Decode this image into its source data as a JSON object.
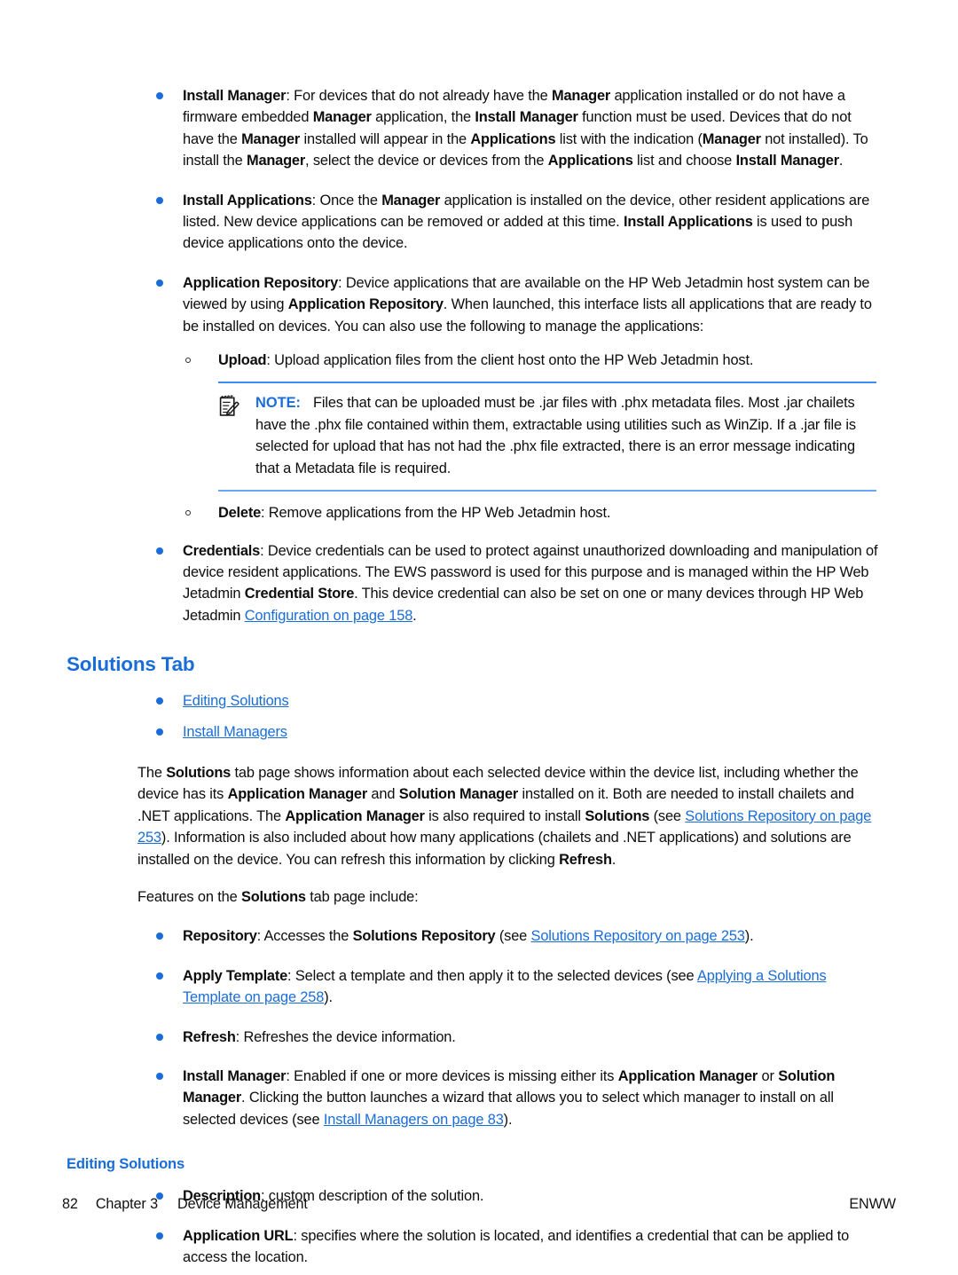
{
  "document": {
    "page_number": "82",
    "chapter": "Chapter 3",
    "chapter_title": "Device Management",
    "footer_right": "ENWW",
    "accent_color": "#1a6dd8",
    "link_color": "#1a6dd8"
  },
  "bullets_top": [
    {
      "name": "install-manager",
      "term": "Install Manager",
      "text_html": "<b>Install Manager</b>: For devices that do not already have the <b>Manager</b> application installed or do not have a firmware embedded <b>Manager</b> application, the <b>Install Manager</b> function must be used. Devices that do not have the <b>Manager</b> installed will appear in the <b>Applications</b> list with the indication (<b>Manager</b> not installed). To install the <b>Manager</b>, select the device or devices from the <b>Applications</b> list and choose <b>Install Manager</b>."
    },
    {
      "name": "install-applications",
      "term": "Install Applications",
      "text_html": "<b>Install Applications</b>: Once the <b>Manager</b> application is installed on the device, other resident applications are listed. New device applications can be removed or added at this time. <b>Install Applications</b> is used to push device applications onto the device."
    },
    {
      "name": "application-repository",
      "term": "Application Repository",
      "text_html": "<b>Application Repository</b>: Device applications that are available on the HP Web Jetadmin host system can be viewed by using <b>Application Repository</b>. When launched, this interface lists all applications that are ready to be installed on devices. You can also use the following to manage the applications:"
    }
  ],
  "sub_bullets": [
    {
      "name": "upload",
      "term": "Upload",
      "text_html": "<b>Upload</b>: Upload application files from the client host onto the HP Web Jetadmin host."
    },
    {
      "name": "delete",
      "term": "Delete",
      "text_html": "<b>Delete</b>: Remove applications from the HP Web Jetadmin host."
    }
  ],
  "note": {
    "icon": "note-pad-pencil-icon",
    "label": "NOTE:",
    "text": "Files that can be uploaded must be .jar files with .phx metadata files. Most .jar chailets have the .phx file contained within them, extractable using utilities such as WinZip. If a .jar file is selected for upload that has not had the .phx file extracted, there is an error message indicating that a Metadata file is required."
  },
  "credentials_bullet": {
    "name": "credentials",
    "term": "Credentials",
    "text_html": "<b>Credentials</b>: Device credentials can be used to protect against unauthorized downloading and manipulation of device resident applications. The EWS password is used for this purpose and is managed within the HP Web Jetadmin <b>Credential Store</b>. This device credential can also be set on one or many devices through HP Web Jetadmin <a class=\"xref\" href=\"#\" data-name=\"xref-configuration-158\" data-interactable=\"true\">Configuration on page 158</a>."
  },
  "solutions_tab": {
    "heading": "Solutions Tab",
    "links": [
      {
        "name": "link-editing-solutions",
        "label": "Editing Solutions"
      },
      {
        "name": "link-install-managers",
        "label": "Install Managers"
      }
    ],
    "intro_html": "The <b>Solutions</b> tab page shows information about each selected device within the device list, including whether the device has its <b>Application Manager</b> and <b>Solution Manager</b> installed on it. Both are needed to install chailets and .NET applications. The <b>Application Manager</b> is also required to install <b>Solutions</b> (see <a class=\"xref\" href=\"#\" data-name=\"xref-solutions-repository-253\" data-interactable=\"true\">Solutions Repository on page 253</a>). Information is also included about how many applications (chailets and .NET applications) and solutions are installed on the device. You can refresh this information by clicking <b>Refresh</b>.",
    "features_intro_html": "Features on the <b>Solutions</b> tab page include:",
    "features": [
      {
        "name": "repository",
        "term": "Repository",
        "text_html": "<b>Repository</b>: Accesses the <b>Solutions Repository</b> (see <a class=\"xref\" href=\"#\" data-name=\"xref-solutions-repository-253b\" data-interactable=\"true\">Solutions Repository on page 253</a>)."
      },
      {
        "name": "apply-template",
        "term": "Apply Template",
        "text_html": "<b>Apply Template</b>: Select a template and then apply it to the selected devices (see <a class=\"xref\" href=\"#\" data-name=\"xref-applying-solutions-template-258\" data-interactable=\"true\">Applying a Solutions Template on page 258</a>)."
      },
      {
        "name": "refresh",
        "term": "Refresh",
        "text_html": "<b>Refresh</b>: Refreshes the device information."
      },
      {
        "name": "install-manager-feature",
        "term": "Install Manager",
        "text_html": "<b>Install Manager</b>: Enabled if one or more devices is missing either its <b>Application Manager</b> or <b>Solution Manager</b>. Clicking the button launches a wizard that allows you to select which manager to install on all selected devices (see <a class=\"xref\" href=\"#\" data-name=\"xref-install-managers-83\" data-interactable=\"true\">Install Managers on page 83</a>)."
      }
    ]
  },
  "editing_solutions": {
    "heading": "Editing Solutions",
    "items": [
      {
        "name": "description",
        "term": "Description",
        "text_html": "<b>Description</b>: custom description of the solution."
      },
      {
        "name": "application-url",
        "term": "Application URL",
        "text_html": "<b>Application URL</b>: specifies where the solution is located, and identifies a credential that can be applied to access the location."
      }
    ]
  }
}
